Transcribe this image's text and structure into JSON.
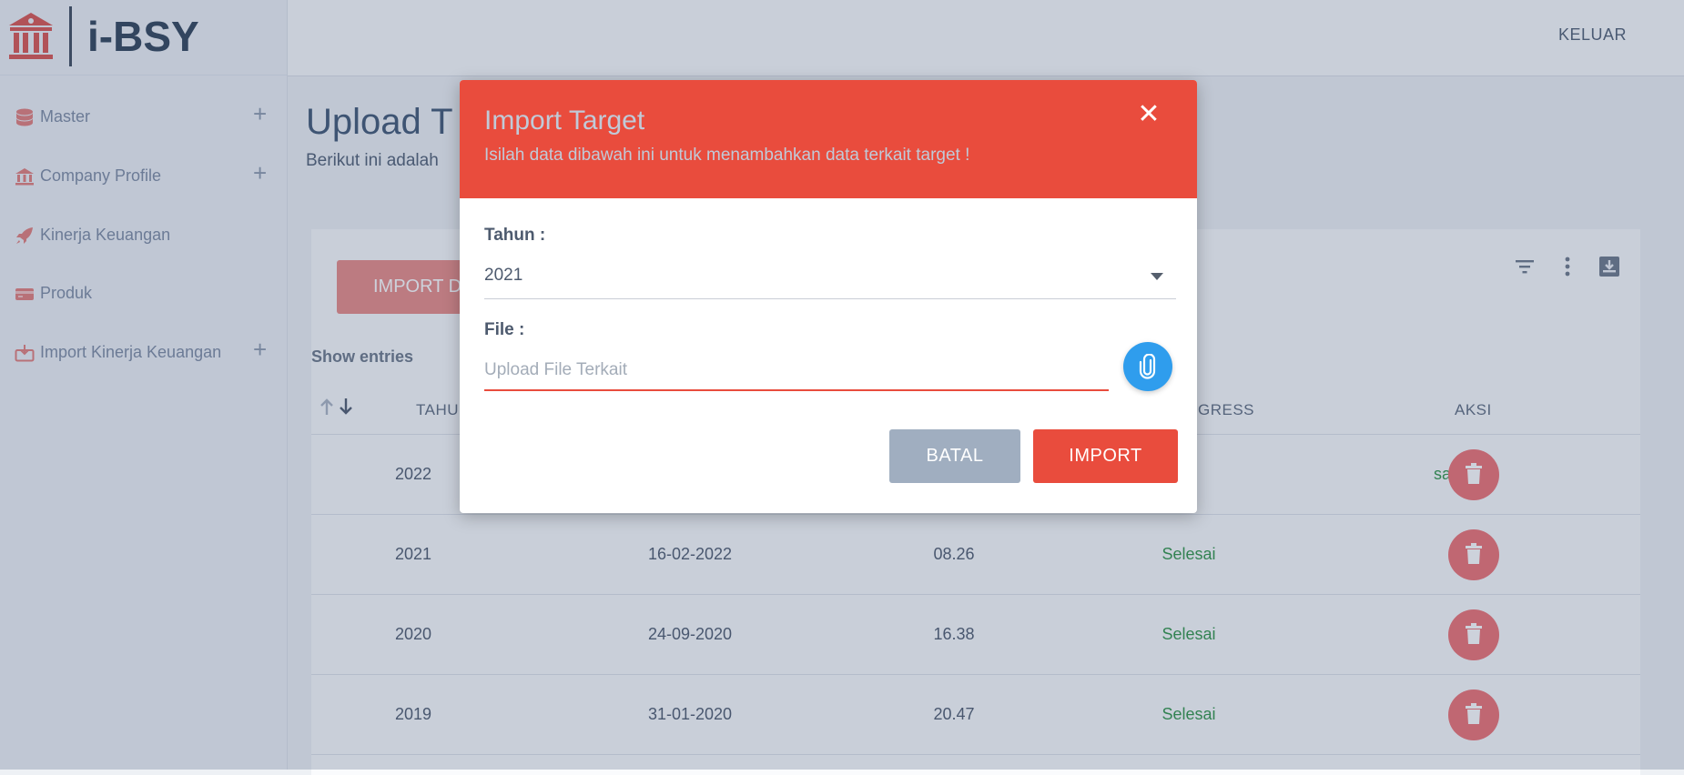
{
  "app": {
    "logo_text": "i-BSY",
    "logout_label": "KELUAR"
  },
  "sidebar": {
    "items": [
      {
        "label": "Master",
        "icon": "database-icon",
        "expandable": true
      },
      {
        "label": "Company Profile",
        "icon": "bank-icon",
        "expandable": true
      },
      {
        "label": "Kinerja Keuangan",
        "icon": "rocket-icon",
        "expandable": false
      },
      {
        "label": "Produk",
        "icon": "credit-card-icon",
        "expandable": false
      },
      {
        "label": "Import Kinerja Keuangan",
        "icon": "import-icon",
        "expandable": true
      }
    ],
    "expand_symbol": "+"
  },
  "main": {
    "title": "Upload T",
    "subtitle": "Berikut ini adalah",
    "import_button_label": "IMPORT D",
    "show_entries_label": "Show entries",
    "table": {
      "headers": [
        "TAHU",
        "GRESS",
        "AKSI"
      ],
      "rows": [
        {
          "tahun": "2022",
          "tanggal": "",
          "waktu": "",
          "status": "sai"
        },
        {
          "tahun": "2021",
          "tanggal": "16-02-2022",
          "waktu": "08.26",
          "status": "Selesai"
        },
        {
          "tahun": "2020",
          "tanggal": "24-09-2020",
          "waktu": "16.38",
          "status": "Selesai"
        },
        {
          "tahun": "2019",
          "tanggal": "31-01-2020",
          "waktu": "20.47",
          "status": "Selesai"
        }
      ]
    }
  },
  "modal": {
    "title": "Import Target",
    "subtitle": "Isilah data dibawah ini untuk menambahkan data terkait target !",
    "close_symbol": "✕",
    "year_label": "Tahun :",
    "year_value": "2021",
    "file_label": "File :",
    "file_placeholder": "Upload File Terkait",
    "cancel_label": "BATAL",
    "import_label": "IMPORT"
  },
  "colors": {
    "accent": "#e94c3d",
    "attach": "#2f9ded",
    "success": "#2f9447",
    "cancel": "#a0aec0"
  }
}
